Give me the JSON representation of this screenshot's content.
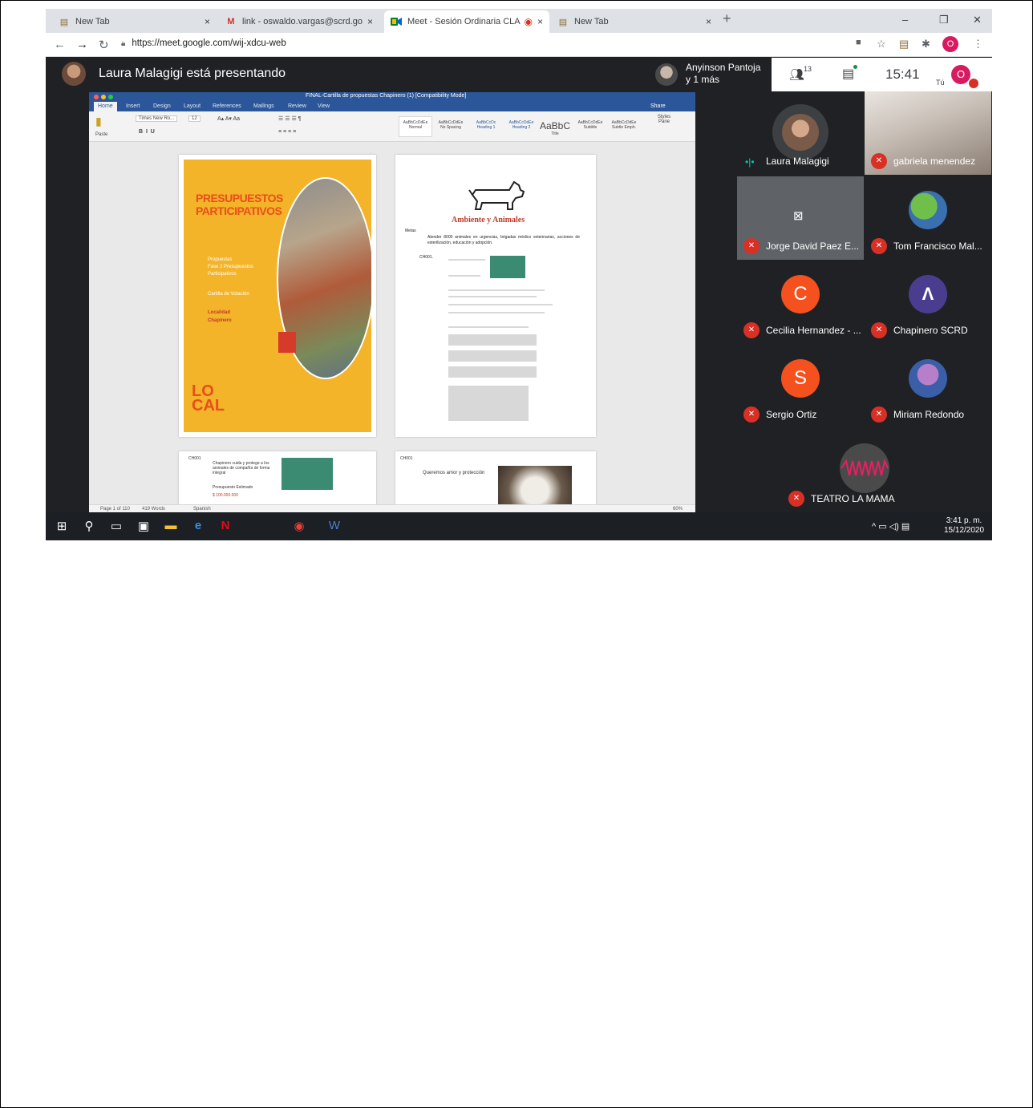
{
  "tabs": [
    {
      "title": "New Tab",
      "close": "×"
    },
    {
      "title": "link - oswaldo.vargas@scrd.gov.c",
      "close": "×"
    },
    {
      "title": "Meet - Sesión Ordinaria CLA",
      "close": "×"
    },
    {
      "title": "New Tab",
      "close": "×"
    }
  ],
  "new_tab": "+",
  "window_controls": {
    "minimize": "–",
    "maximize": "❐",
    "close": "✕"
  },
  "url": "https://meet.google.com/wij-xdcu-web",
  "profile_initial": "O",
  "meet": {
    "presenting_title": "Laura Malagigi está presentando",
    "participant_preview_line1": "Anyinson Pantoja",
    "participant_preview_line2": "y 1 más",
    "people_count": "13",
    "clock": "15:41",
    "self_label": "Tú",
    "self_initial": "O"
  },
  "participants": [
    {
      "name": "Laura Malagigi",
      "speaking": true
    },
    {
      "name": "gabriela menendez",
      "muted": true
    },
    {
      "name": "Jorge David Paez E...",
      "muted": true
    },
    {
      "name": "Tom Francisco Mal...",
      "muted": true
    },
    {
      "name": "Cecilia Hernandez - ...",
      "muted": true,
      "initial": "C",
      "color": "#f4511e"
    },
    {
      "name": "Chapinero SCRD",
      "muted": true
    },
    {
      "name": "Sergio Ortiz",
      "muted": true,
      "initial": "S",
      "color": "#f4511e"
    },
    {
      "name": "Miriam Redondo",
      "muted": true
    },
    {
      "name": "TEATRO LA MAMA",
      "muted": true
    }
  ],
  "word": {
    "doc_title": "FINAL-Cartilla de propuestas Chapinero (1) [Compatibility Mode]",
    "menu": [
      "Home",
      "Insert",
      "Design",
      "Layout",
      "References",
      "Mailings",
      "Review",
      "View"
    ],
    "share": "Share",
    "font_name": "Times New Ro...",
    "font_size": "12",
    "styles": [
      "AaBbCcDdEe",
      "AaBbCcDdEe",
      "AaBbCcDc",
      "AaBbCcDdEe",
      "AaBbC",
      "AaBbCcDdEe",
      "AaBbCcDdEe"
    ],
    "style_names": [
      "Normal",
      "No Spacing",
      "Heading 1",
      "Heading 2",
      "Title",
      "Subtitle",
      "Subtle Emph."
    ],
    "styles_pane": "Styles Pane",
    "paste": "Paste",
    "status_page": "Page 1 of 110",
    "status_words": "419 Words",
    "status_lang": "Spanish",
    "zoom": "60%"
  },
  "cover": {
    "title_line1": "PRESUPUESTOS",
    "title_line2": "PARTICIPATIVOS",
    "sub1": "Propuestas",
    "sub2": "Fase 2 Presupuestos",
    "sub3": "Participativos",
    "cartilla": "Cartilla de Votación",
    "loc1": "Localidad",
    "loc2": "Chapinero",
    "local_big1": "LO",
    "local_big2": "CAL"
  },
  "page2": {
    "title": "Ambiente y Animales",
    "metas": "Metas",
    "bullet": "Atender 8000 animales en urgencias, brigadas médico veterinarias, acciones de esterilización, educación y adopción.",
    "code": "CH001."
  },
  "page3": {
    "code": "CH001",
    "text": "Chapinero cuida y protege a los animales de compañía de forma integral",
    "presupuesto": "Presupuesto Estimado",
    "amount": "$ 100.000.000"
  },
  "page4": {
    "code": "CH001",
    "text": "Queremos amor y protección"
  },
  "taskbar": {
    "time": "3:41 p. m.",
    "date": "15/12/2020"
  },
  "colors": {
    "meet_bg": "#202124",
    "mute_red": "#d93025",
    "word_blue": "#2b579a",
    "cover_yellow": "#f4b42a",
    "accent_orange": "#e84e1b"
  }
}
